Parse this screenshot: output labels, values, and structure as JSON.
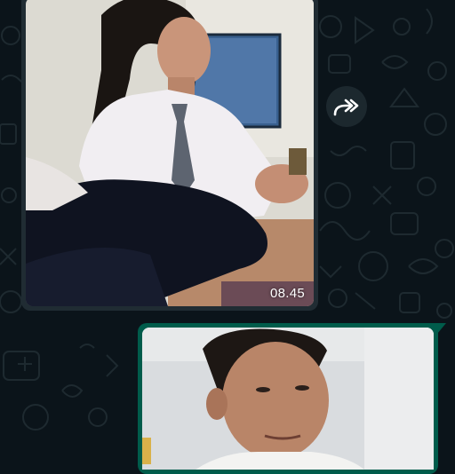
{
  "chat": {
    "background_color": "#0b141a",
    "incoming_bubble_color": "#202c33",
    "outgoing_bubble_color": "#005c4b"
  },
  "messages": [
    {
      "direction": "incoming",
      "type": "image",
      "timestamp": "08.45"
    },
    {
      "direction": "outgoing",
      "type": "image"
    }
  ],
  "icons": {
    "forward": "forward-icon"
  }
}
